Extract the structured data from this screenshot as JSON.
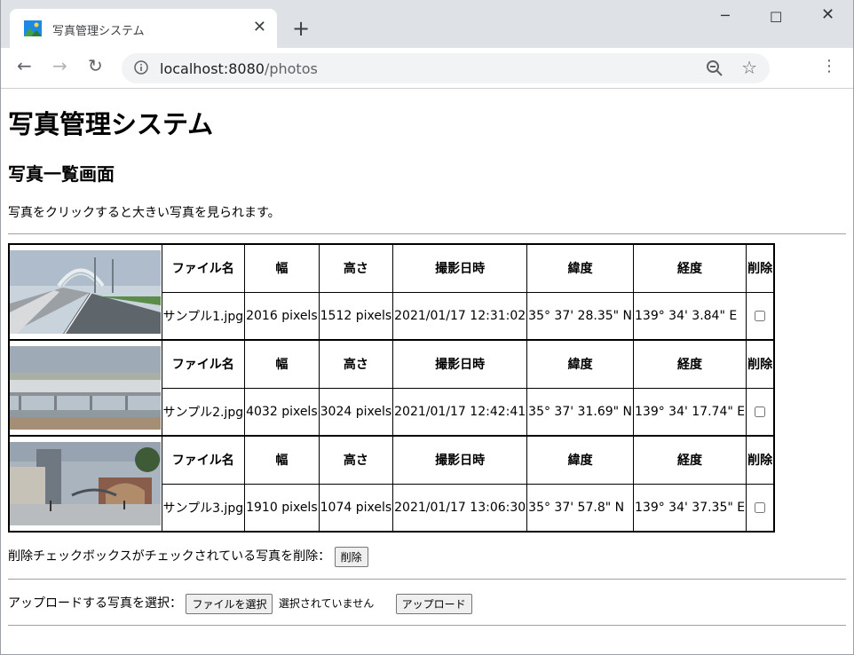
{
  "browser": {
    "tab_title": "写真管理システム",
    "url_host": "localhost:8080",
    "url_path": "/photos"
  },
  "page": {
    "title": "写真管理システム",
    "subtitle": "写真一覧画面",
    "intro": "写真をクリックすると大きい写真を見られます。",
    "headers": {
      "filename": "ファイル名",
      "width": "幅",
      "height": "高さ",
      "datetime": "撮影日時",
      "latitude": "緯度",
      "longitude": "経度",
      "delete": "削除"
    },
    "photos": [
      {
        "filename": "サンプル1.jpg",
        "width": "2016 pixels",
        "height": "1512 pixels",
        "datetime": "2021/01/17 12:31:02",
        "latitude": "35° 37' 28.35\" N",
        "longitude": "139° 34' 3.84\" E",
        "checked": false
      },
      {
        "filename": "サンプル2.jpg",
        "width": "4032 pixels",
        "height": "3024 pixels",
        "datetime": "2021/01/17 12:42:41",
        "latitude": "35° 37' 31.69\" N",
        "longitude": "139° 34' 17.74\" E",
        "checked": false
      },
      {
        "filename": "サンプル3.jpg",
        "width": "1910 pixels",
        "height": "1074 pixels",
        "datetime": "2021/01/17 13:06:30",
        "latitude": "35° 37' 57.8\" N",
        "longitude": "139° 34' 37.35\" E",
        "checked": false
      }
    ],
    "delete_label": "削除チェックボックスがチェックされている写真を削除：",
    "delete_button": "削除",
    "upload_label": "アップロードする写真を選択：",
    "choose_file_button": "ファイルを選択",
    "no_file_text": "選択されていません",
    "upload_button": "アップロード"
  }
}
